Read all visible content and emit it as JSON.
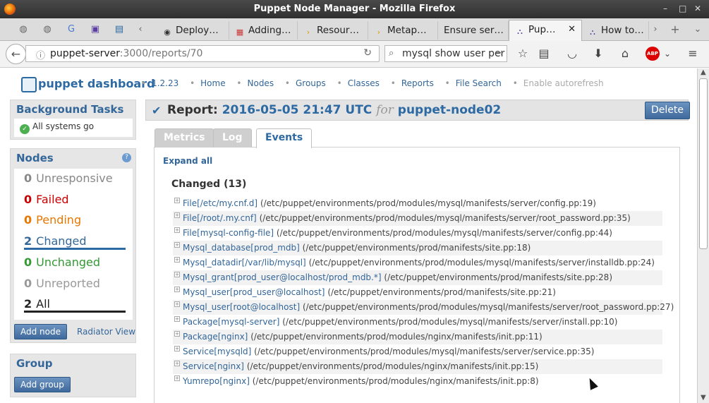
{
  "window": {
    "title": "Puppet Node Manager - Mozilla Firefox",
    "min": "–",
    "max": "□",
    "close": "✕"
  },
  "tabs": [
    {
      "label": "Deploy…",
      "icon": "github-icon"
    },
    {
      "label": "Adding…",
      "icon": "grid-icon"
    },
    {
      "label": "Resour…",
      "icon": "chevron-icon"
    },
    {
      "label": "Metap…",
      "icon": "chevron-icon"
    },
    {
      "label": "Ensure ser…",
      "icon": "none"
    },
    {
      "label": "Pup…",
      "icon": "puppet-icon",
      "active": true
    },
    {
      "label": "How to…",
      "icon": "puppet-icon"
    }
  ],
  "nav": {
    "url_host": "puppet-server",
    "url_path": ":3000/reports/70",
    "search_value": "mysql show user per",
    "back": "←",
    "reload": "↻",
    "go": "→"
  },
  "toolbar": {
    "abp": "ABP"
  },
  "dashboard": {
    "brand": "puppet dashboard",
    "version": "1.2.23",
    "links": [
      "Home",
      "Nodes",
      "Groups",
      "Classes",
      "Reports",
      "File Search"
    ],
    "autorefresh": "Enable autorefresh"
  },
  "background_tasks": {
    "title": "Background Tasks",
    "status": "All systems go"
  },
  "nodes": {
    "title": "Nodes",
    "help": "?",
    "statuses": [
      {
        "count": "0",
        "label": "Unresponsive",
        "color": "#888888"
      },
      {
        "count": "0",
        "label": "Failed",
        "color": "#cc0000"
      },
      {
        "count": "0",
        "label": "Pending",
        "color": "#e87700"
      },
      {
        "count": "2",
        "label": "Changed",
        "color": "#336699"
      },
      {
        "count": "0",
        "label": "Unchanged",
        "color": "#339933"
      },
      {
        "count": "0",
        "label": "Unreported",
        "color": "#999999"
      },
      {
        "count": "2",
        "label": "All",
        "color": "#222222"
      }
    ],
    "add_node": "Add node",
    "radiator": "Radiator View"
  },
  "group": {
    "title": "Group",
    "add_group": "Add group"
  },
  "report": {
    "prefix": "Report:",
    "datetime": "2016-05-05 21:47 UTC",
    "for": "for",
    "node": "puppet-node02",
    "delete": "Delete"
  },
  "panel_tabs": [
    "Metrics",
    "Log",
    "Events"
  ],
  "expand_all": "Expand all",
  "changed_heading": "Changed (13)",
  "events": [
    {
      "resource": "File[/etc/my.cnf.d]",
      "path": "(/etc/puppet/environments/prod/modules/mysql/manifests/server/config.pp:19)"
    },
    {
      "resource": "File[/root/.my.cnf]",
      "path": "(/etc/puppet/environments/prod/modules/mysql/manifests/server/root_password.pp:35)"
    },
    {
      "resource": "File[mysql-config-file]",
      "path": "(/etc/puppet/environments/prod/modules/mysql/manifests/server/config.pp:44)"
    },
    {
      "resource": "Mysql_database[prod_mdb]",
      "path": "(/etc/puppet/environments/prod/manifests/site.pp:18)"
    },
    {
      "resource": "Mysql_datadir[/var/lib/mysql]",
      "path": "(/etc/puppet/environments/prod/modules/mysql/manifests/server/installdb.pp:24)"
    },
    {
      "resource": "Mysql_grant[prod_user@localhost/prod_mdb.*]",
      "path": "(/etc/puppet/environments/prod/manifests/site.pp:28)"
    },
    {
      "resource": "Mysql_user[prod_user@localhost]",
      "path": "(/etc/puppet/environments/prod/manifests/site.pp:21)"
    },
    {
      "resource": "Mysql_user[root@localhost]",
      "path": "(/etc/puppet/environments/prod/modules/mysql/manifests/server/root_password.pp:27)"
    },
    {
      "resource": "Package[mysql-server]",
      "path": "(/etc/puppet/environments/prod/modules/mysql/manifests/server/install.pp:10)"
    },
    {
      "resource": "Package[nginx]",
      "path": "(/etc/puppet/environments/prod/modules/nginx/manifests/init.pp:11)"
    },
    {
      "resource": "Service[mysqld]",
      "path": "(/etc/puppet/environments/prod/modules/mysql/manifests/server/service.pp:35)"
    },
    {
      "resource": "Service[nginx]",
      "path": "(/etc/puppet/environments/prod/modules/nginx/manifests/init.pp:15)"
    },
    {
      "resource": "Yumrepo[nginx]",
      "path": "(/etc/puppet/environments/prod/modules/nginx/manifests/init.pp:8)"
    }
  ]
}
